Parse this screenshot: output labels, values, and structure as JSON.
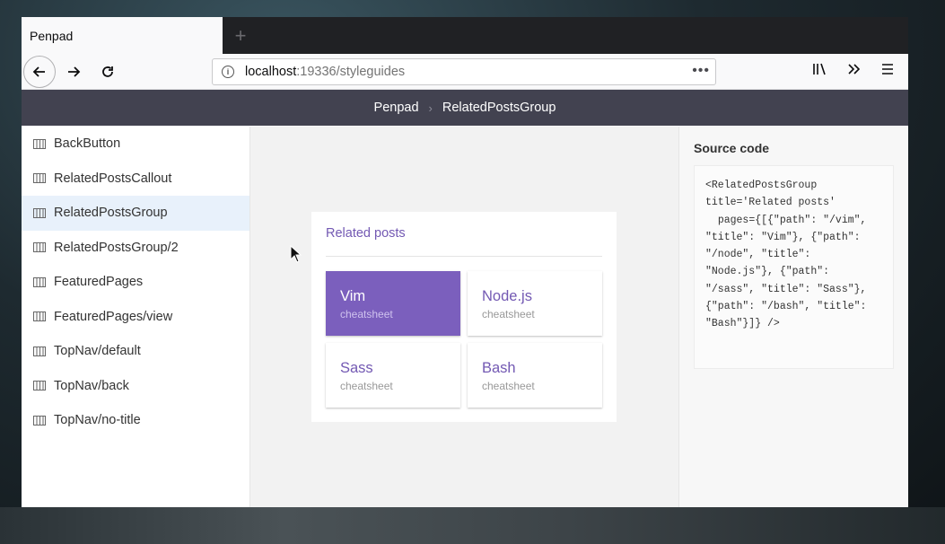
{
  "browser": {
    "tab_title": "Penpad",
    "new_tab_glyph": "+",
    "url_host": "localhost",
    "url_rest": ":19336/styleguides",
    "url_more": "•••"
  },
  "header": {
    "crumb_root": "Penpad",
    "crumb_current": "RelatedPostsGroup"
  },
  "sidebar": {
    "items": [
      {
        "label": "BackButton"
      },
      {
        "label": "RelatedPostsCallout"
      },
      {
        "label": "RelatedPostsGroup"
      },
      {
        "label": "RelatedPostsGroup/2"
      },
      {
        "label": "FeaturedPages"
      },
      {
        "label": "FeaturedPages/view"
      },
      {
        "label": "TopNav/default"
      },
      {
        "label": "TopNav/back"
      },
      {
        "label": "TopNav/no-title"
      }
    ],
    "active_index": 2
  },
  "preview": {
    "title": "Related posts",
    "posts": [
      {
        "title": "Vim",
        "subtitle": "cheatsheet"
      },
      {
        "title": "Node.js",
        "subtitle": "cheatsheet"
      },
      {
        "title": "Sass",
        "subtitle": "cheatsheet"
      },
      {
        "title": "Bash",
        "subtitle": "cheatsheet"
      }
    ]
  },
  "source": {
    "title": "Source code",
    "code": "<RelatedPostsGroup\ntitle='Related posts'\n  pages={[{\"path\": \"/vim\",\n\"title\": \"Vim\"}, {\"path\":\n\"/node\", \"title\":\n\"Node.js\"}, {\"path\":\n\"/sass\", \"title\": \"Sass\"},\n{\"path\": \"/bash\", \"title\":\n\"Bash\"}]} />"
  },
  "colors": {
    "accent": "#7359b3",
    "featured_bg": "#7b5fbd",
    "header_bg": "#424250",
    "active_row": "#e8f1fb"
  }
}
